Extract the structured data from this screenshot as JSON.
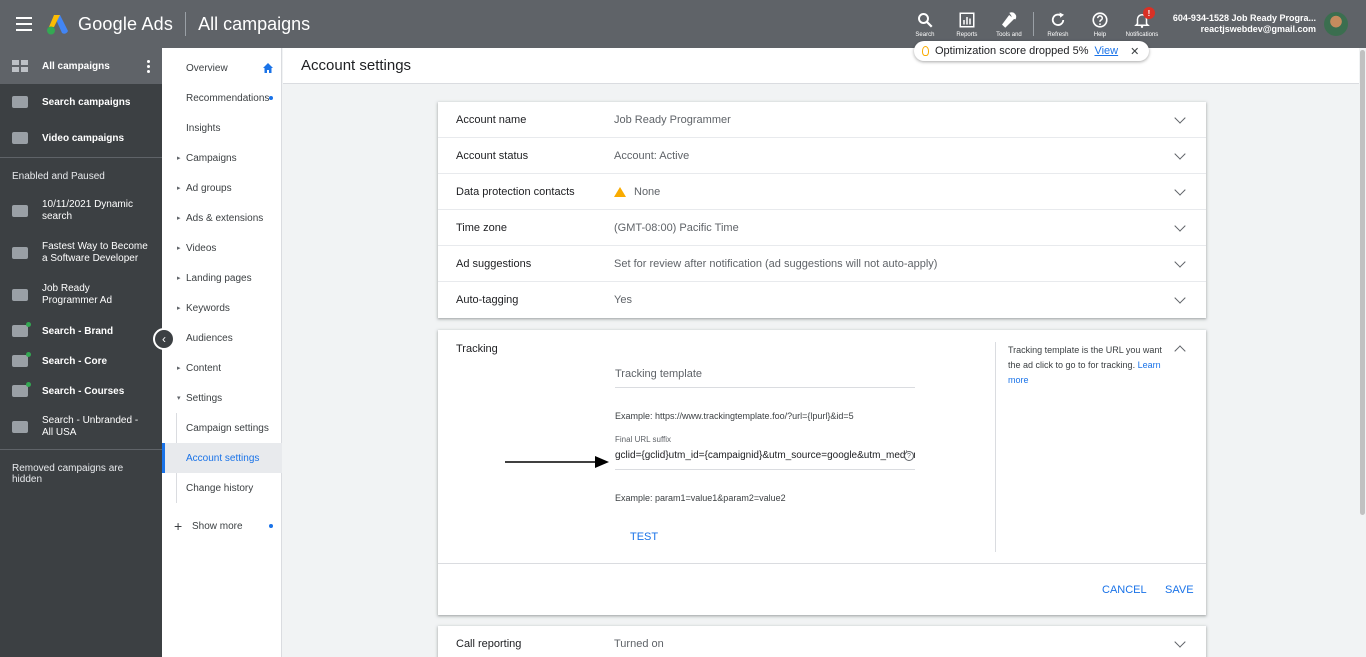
{
  "topbar": {
    "brand": "Google Ads",
    "page": "All campaigns",
    "tools": [
      {
        "label": "Search",
        "icon": "search-icon"
      },
      {
        "label": "Reports",
        "icon": "reports-icon"
      },
      {
        "label": "Tools and",
        "icon": "wrench-icon"
      },
      {
        "label": "Refresh",
        "icon": "refresh-icon"
      },
      {
        "label": "Help",
        "icon": "help-icon"
      },
      {
        "label": "Notifications",
        "icon": "bell-icon"
      }
    ],
    "notif_badge": "!",
    "account_line1": "604-934-1528 Job Ready Progra...",
    "account_line2": "reactjswebdev@gmail.com"
  },
  "leftnav": {
    "top_items": [
      {
        "label": "All campaigns"
      },
      {
        "label": "Search campaigns"
      },
      {
        "label": "Video campaigns"
      }
    ],
    "section": "Enabled and Paused",
    "campaigns": [
      {
        "label": "10/11/2021 Dynamic search"
      },
      {
        "label": "Fastest Way to Become a Software Developer"
      },
      {
        "label": "Job Ready Programmer Ad"
      },
      {
        "label": "Search - Brand"
      },
      {
        "label": "Search - Core"
      },
      {
        "label": "Search - Courses"
      },
      {
        "label": "Search - Unbranded - All USA"
      }
    ],
    "footer": "Removed campaigns are hidden"
  },
  "pagemenu": {
    "overview": "Overview",
    "recommendations": "Recommendations",
    "insights": "Insights",
    "campaigns": "Campaigns",
    "ad_groups": "Ad groups",
    "ads": "Ads & extensions",
    "videos": "Videos",
    "landing": "Landing pages",
    "keywords": "Keywords",
    "audiences": "Audiences",
    "content": "Content",
    "settings": "Settings",
    "campaign_settings": "Campaign settings",
    "account_settings": "Account settings",
    "change_history": "Change history",
    "show_more": "Show more"
  },
  "content": {
    "title": "Account settings",
    "opt_text": "Optimization score dropped 5%",
    "opt_link": "View",
    "rows": [
      {
        "label": "Account name",
        "value": "Job Ready Programmer"
      },
      {
        "label": "Account status",
        "value": "Account: Active"
      },
      {
        "label": "Data protection contacts",
        "value": "None"
      },
      {
        "label": "Time zone",
        "value": "(GMT-08:00) Pacific Time"
      },
      {
        "label": "Ad suggestions",
        "value": "Set for review after notification (ad suggestions will not auto-apply)"
      },
      {
        "label": "Auto-tagging",
        "value": "Yes"
      }
    ],
    "tracking": {
      "label": "Tracking",
      "template_placeholder": "Tracking template",
      "example1": "Example: https://www.trackingtemplate.foo/?url={lpurl}&id=5",
      "final_label": "Final URL suffix",
      "final_value": "gclid={gclid}utm_id={campaignid}&utm_source=google&utm_medium=cpc",
      "example2": "Example: param1=value1&param2=value2",
      "test": "TEST",
      "help_text": "Tracking template is the URL you want the ad click to go to for tracking.",
      "help_link": "Learn more",
      "cancel": "CANCEL",
      "save": "SAVE"
    },
    "call_reporting": {
      "label": "Call reporting",
      "value": "Turned on"
    }
  }
}
